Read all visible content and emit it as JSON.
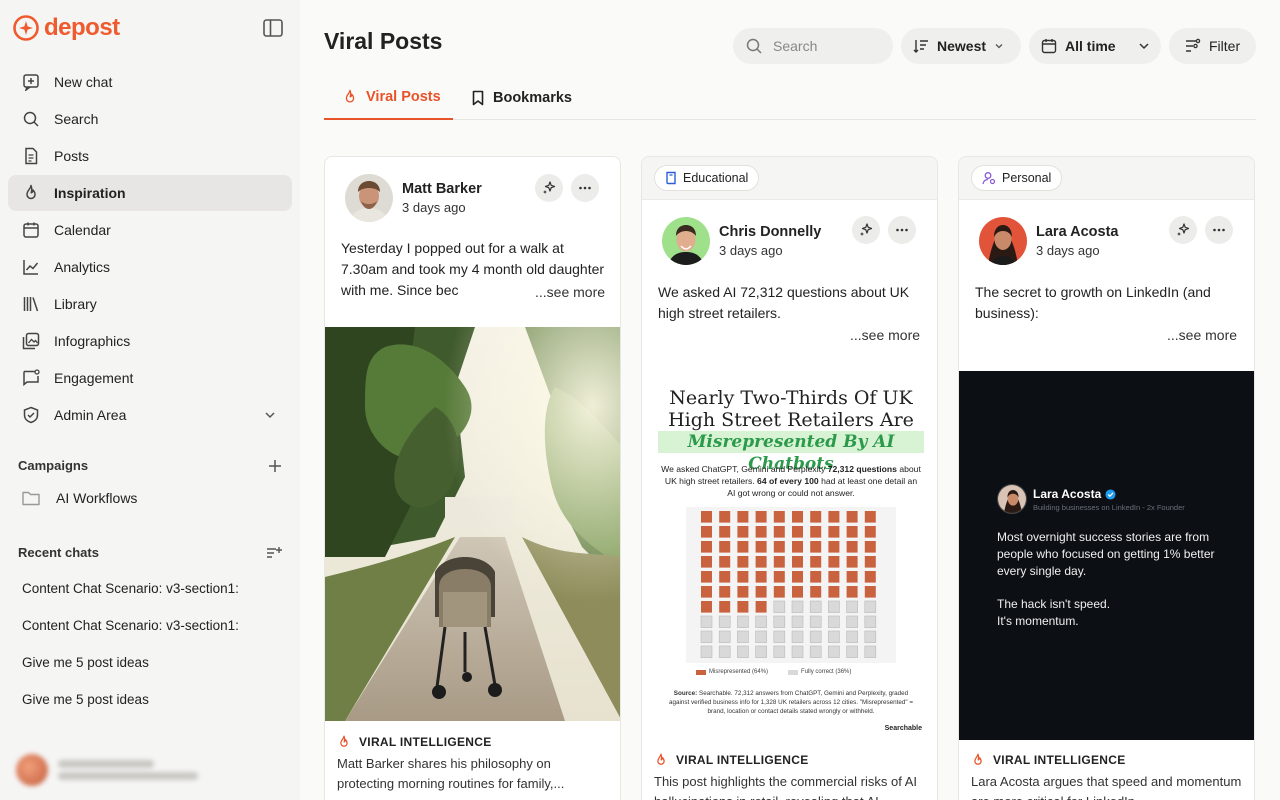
{
  "app": {
    "brand": "depost",
    "accent": "#ef5a2e"
  },
  "sidebar": {
    "nav": [
      {
        "label": "New chat",
        "icon": "new-chat-icon"
      },
      {
        "label": "Search",
        "icon": "search-icon"
      },
      {
        "label": "Posts",
        "icon": "document-icon"
      },
      {
        "label": "Inspiration",
        "icon": "flame-icon",
        "active": true
      },
      {
        "label": "Calendar",
        "icon": "calendar-icon"
      },
      {
        "label": "Analytics",
        "icon": "chart-icon"
      },
      {
        "label": "Library",
        "icon": "library-icon"
      },
      {
        "label": "Infographics",
        "icon": "image-icon"
      },
      {
        "label": "Engagement",
        "icon": "message-icon"
      },
      {
        "label": "Admin Area",
        "icon": "shield-icon"
      }
    ],
    "campaigns": {
      "title": "Campaigns",
      "items": [
        "AI Workflows"
      ]
    },
    "recent": {
      "title": "Recent chats",
      "items": [
        "Content Chat Scenario: v3-section1:",
        "Content Chat Scenario: v3-section1:",
        "Give me 5 post ideas",
        "Give me 5 post ideas"
      ]
    }
  },
  "main": {
    "title": "Viral Posts",
    "search": {
      "placeholder": "Search"
    },
    "sort": {
      "label": "Newest"
    },
    "time": {
      "label": "All time"
    },
    "filter": {
      "label": "Filter"
    },
    "tabs": [
      {
        "label": "Viral Posts",
        "active": true
      },
      {
        "label": "Bookmarks"
      }
    ]
  },
  "cards": [
    {
      "tag": "",
      "author": "Matt Barker",
      "time": "3 days ago",
      "text": "Yesterday I popped out for a walk at 7.30am and took my 4 month old daughter with me. Since bec",
      "see_more": "...see more",
      "viral_label": "VIRAL INTELLIGENCE",
      "summary": "Matt Barker shares his philosophy on protecting morning routines for family,..."
    },
    {
      "tag": "Educational",
      "author": "Chris Donnelly",
      "time": "3 days ago",
      "text": "We asked AI 72,312 questions about UK high street retailers.",
      "see_more": "...see more",
      "viral_label": "VIRAL INTELLIGENCE",
      "summary": "This post highlights the commercial risks of AI hallucinations in retail, revealing that AI",
      "infographic": {
        "title": "Nearly Two-Thirds Of UK High Street Retailers Are",
        "highlight": "Misrepresented By AI Chatbots",
        "body_pre": "We asked ChatGPT, Gemini and Perplexity ",
        "body_bold1": "72,312 questions",
        "body_mid": " about UK high street retailers. ",
        "body_bold2": "64 of every 100",
        "body_post": " had at least one detail an AI got wrong or could not answer.",
        "legend_a": "Misrepresented (64%)",
        "legend_b": "Fully correct (36%)",
        "source_label": "Source:",
        "source": " Searchable. 72,312 answers from ChatGPT, Gemini and Perplexity, graded against verified business info for 1,328 UK retailers across 12 cities. \"Misrepresented\" = brand, location or contact details stated wrongly or withheld.",
        "brand": "Searchable",
        "misrepresented_pct": 64,
        "colors": {
          "misrepresented": "#c9623f",
          "correct": "#d9d9d9",
          "highlight": "#2c9a4b"
        }
      }
    },
    {
      "tag": "Personal",
      "author": "Lara Acosta",
      "time": "3 days ago",
      "text": "The secret to growth on LinkedIn (and business):",
      "see_more": "...see more",
      "viral_label": "VIRAL INTELLIGENCE",
      "summary": "Lara Acosta argues that speed and momentum are more critical for LinkedIn",
      "quote": {
        "name": "Lara Acosta",
        "subtitle": "Building businesses on LinkedIn - 2x Founder",
        "p1": "Most overnight success stories are from people who focused on getting 1% better every single day.",
        "p2": "The hack isn't speed.",
        "p3": "It's momentum."
      }
    }
  ]
}
